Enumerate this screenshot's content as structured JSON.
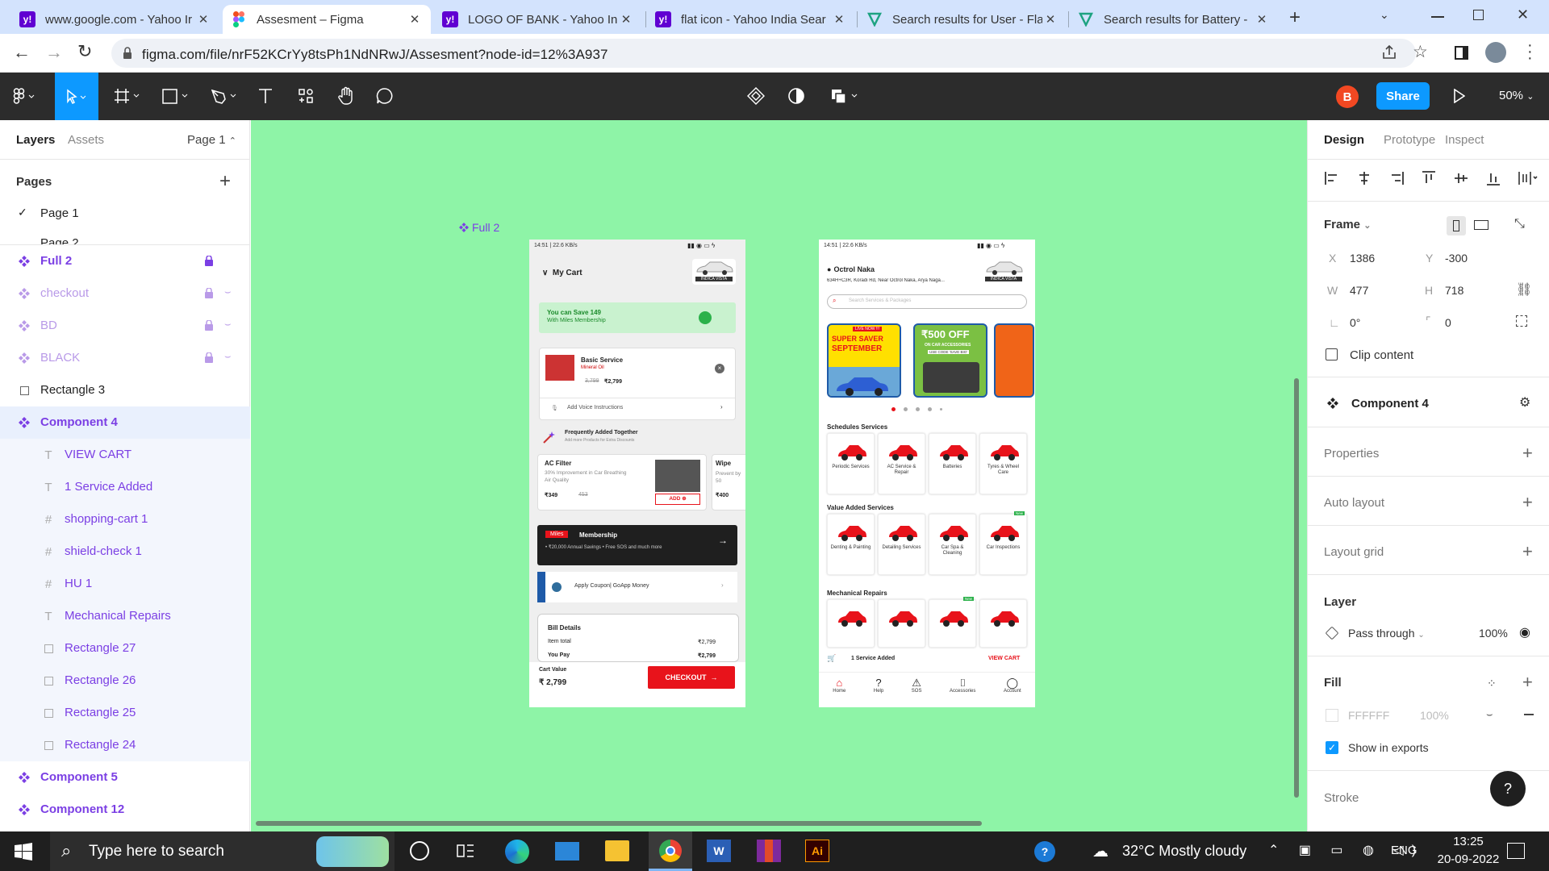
{
  "browser": {
    "tabs": [
      {
        "title": "www.google.com - Yahoo Ir",
        "favicon": "yahoo-icon"
      },
      {
        "title": "Assesment – Figma",
        "favicon": "figma-icon"
      },
      {
        "title": "LOGO OF BANK - Yahoo Inc",
        "favicon": "yahoo-icon"
      },
      {
        "title": "flat icon - Yahoo India Sear",
        "favicon": "yahoo-icon"
      },
      {
        "title": "Search results for User - Fla",
        "favicon": "flaticon-icon"
      },
      {
        "title": "Search results for Battery -",
        "favicon": "flaticon-icon"
      }
    ],
    "url": "figma.com/file/nrF52KCrYy8tsPh1NdNRwJ/Assesment?node-id=12%3A937"
  },
  "toolbar": {
    "avatar_letter": "B",
    "share_label": "Share",
    "zoom": "50%"
  },
  "left_panel": {
    "tab_layers": "Layers",
    "tab_assets": "Assets",
    "page_selector": "Page 1",
    "pages_heading": "Pages",
    "pages": [
      "Page 1",
      "Page 2"
    ],
    "layers": [
      {
        "label": "Full 2",
        "type": "component",
        "indent": 0,
        "locked": true,
        "hidden": false,
        "style": "purple"
      },
      {
        "label": "checkout",
        "type": "component",
        "indent": 0,
        "locked": true,
        "hidden": true,
        "style": "faded"
      },
      {
        "label": "BD",
        "type": "component",
        "indent": 0,
        "locked": true,
        "hidden": true,
        "style": "faded"
      },
      {
        "label": "BLACK",
        "type": "component",
        "indent": 0,
        "locked": true,
        "hidden": true,
        "style": "faded"
      },
      {
        "label": "Rectangle 3",
        "type": "rect",
        "indent": 0,
        "locked": false,
        "hidden": false,
        "style": "normal"
      },
      {
        "label": "Component 4",
        "type": "component",
        "indent": 0,
        "locked": false,
        "hidden": false,
        "style": "purple-selected"
      },
      {
        "label": "VIEW CART",
        "type": "text",
        "indent": 1,
        "locked": false,
        "hidden": false,
        "style": "purple-child"
      },
      {
        "label": "1 Service Added",
        "type": "text",
        "indent": 1,
        "locked": false,
        "hidden": false,
        "style": "purple-child"
      },
      {
        "label": "shopping-cart 1",
        "type": "frame",
        "indent": 1,
        "locked": false,
        "hidden": false,
        "style": "purple-child"
      },
      {
        "label": "shield-check 1",
        "type": "frame",
        "indent": 1,
        "locked": false,
        "hidden": false,
        "style": "purple-child"
      },
      {
        "label": "HU 1",
        "type": "frame",
        "indent": 1,
        "locked": false,
        "hidden": false,
        "style": "purple-child"
      },
      {
        "label": "Mechanical Repairs",
        "type": "text",
        "indent": 1,
        "locked": false,
        "hidden": false,
        "style": "purple-child"
      },
      {
        "label": "Rectangle 27",
        "type": "rect",
        "indent": 1,
        "locked": false,
        "hidden": false,
        "style": "purple-child"
      },
      {
        "label": "Rectangle 26",
        "type": "rect",
        "indent": 1,
        "locked": false,
        "hidden": false,
        "style": "purple-child"
      },
      {
        "label": "Rectangle 25",
        "type": "rect",
        "indent": 1,
        "locked": false,
        "hidden": false,
        "style": "purple-child"
      },
      {
        "label": "Rectangle 24",
        "type": "rect",
        "indent": 1,
        "locked": false,
        "hidden": false,
        "style": "purple-child"
      },
      {
        "label": "Component 5",
        "type": "component",
        "indent": 0,
        "locked": false,
        "hidden": false,
        "style": "purple"
      },
      {
        "label": "Component 12",
        "type": "component",
        "indent": 0,
        "locked": false,
        "hidden": false,
        "style": "purple"
      }
    ]
  },
  "canvas": {
    "frame_label": "Full 2",
    "cart_screen": {
      "status": "14:51 | 22.6 KB/s",
      "title": "My Cart",
      "car_badge": "INDICA VISTA",
      "save_title": "You can Save  149",
      "save_sub": "With Miles Membership",
      "service_name": "Basic Service",
      "service_sub": "Mineral Oil",
      "service_old_price": "3,799",
      "service_price": "₹2,799",
      "voice": "Add Voice Instructions",
      "fat_title": "Frequently Added Together",
      "fat_sub": "Add more Products for Extra Discounts",
      "ac_title": "AC Filter",
      "ac_desc": "30% Improvement in Car Breathing Air Quality",
      "ac_price": "₹349",
      "ac_old": "453",
      "add_label": "ADD",
      "wipe_title": "Wipe",
      "wipe_desc": "Prevent by 50",
      "wipe_price": "₹400",
      "miles_tag": "Miles",
      "membership": "Membership",
      "membership_sub": "• ₹20,000 Annual Savings   • Free SOS and much more",
      "coupon": "Apply Coupon| GoApp Money",
      "bill_title": "Bill Details",
      "item_total_label": "Item total",
      "item_total": "₹2,799",
      "you_pay_label": "You Pay",
      "you_pay": "₹2,799",
      "cart_value_label": "Cart Value",
      "cart_value": "₹ 2,799",
      "checkout": "CHECKOUT"
    },
    "home_screen": {
      "status": "14:51 | 22.6 KB/s",
      "location": "Octrol Naka",
      "address": "634H+C3R, Koradi Rd, Near Octrol Naka, Arya Naga...",
      "car_badge": "INDICA VISTA",
      "search_placeholder": "Search Services & Packages",
      "banner1_tag": "LIVE NOW !!!",
      "banner1_title1": "SUPER SAVER",
      "banner1_title2": "SEPTEMBER",
      "banner2_title": "₹500 OFF",
      "banner2_sub": "ON CAR ACCESSORIES",
      "banner2_code": "USE CODE 'SAVE BIG'",
      "schedules_title": "Schedules Services",
      "schedules": [
        "Periodic Services",
        "AC Service & Repair",
        "Batteries",
        "Tyres & Wheel Care"
      ],
      "value_title": "Value Added Services",
      "value_services": [
        "Denting & Painting",
        "Detailing Services",
        "Car Spa & Cleaning",
        "Car Inspections"
      ],
      "new_badge": "New",
      "mech_title": "Mechanical Repairs",
      "cart_bar_text": "1 Service Added",
      "view_cart": "VIEW CART",
      "nav": [
        "Home",
        "Help",
        "SOS",
        "Accessories",
        "Account"
      ]
    }
  },
  "right_panel": {
    "tabs": [
      "Design",
      "Prototype",
      "Inspect"
    ],
    "frame_label": "Frame",
    "x_label": "X",
    "x": "1386",
    "y_label": "Y",
    "y": "-300",
    "w_label": "W",
    "w": "477",
    "h_label": "H",
    "h": "718",
    "rotation": "0°",
    "radius": "0",
    "clip_content": "Clip content",
    "component_name": "Component 4",
    "properties": "Properties",
    "auto_layout": "Auto layout",
    "layout_grid": "Layout grid",
    "layer_title": "Layer",
    "blend_mode": "Pass through",
    "opacity": "100%",
    "fill_title": "Fill",
    "fill_hex": "FFFFFF",
    "fill_opacity": "100%",
    "show_in_exports": "Show in exports",
    "stroke_title": "Stroke",
    "help": "?"
  },
  "taskbar": {
    "search_placeholder": "Type here to search",
    "weather": "32°C  Mostly cloudy",
    "lang": "ENG",
    "time": "13:25",
    "date": "20-09-2022"
  },
  "colors": {
    "canvas_bg": "#8ef4a7",
    "figma_toolbar": "#2c2c2c",
    "figma_blue": "#0d99ff",
    "component_purple": "#7b3fe4",
    "brand_red": "#e8131b",
    "tab_strip": "#d3e3fd"
  }
}
